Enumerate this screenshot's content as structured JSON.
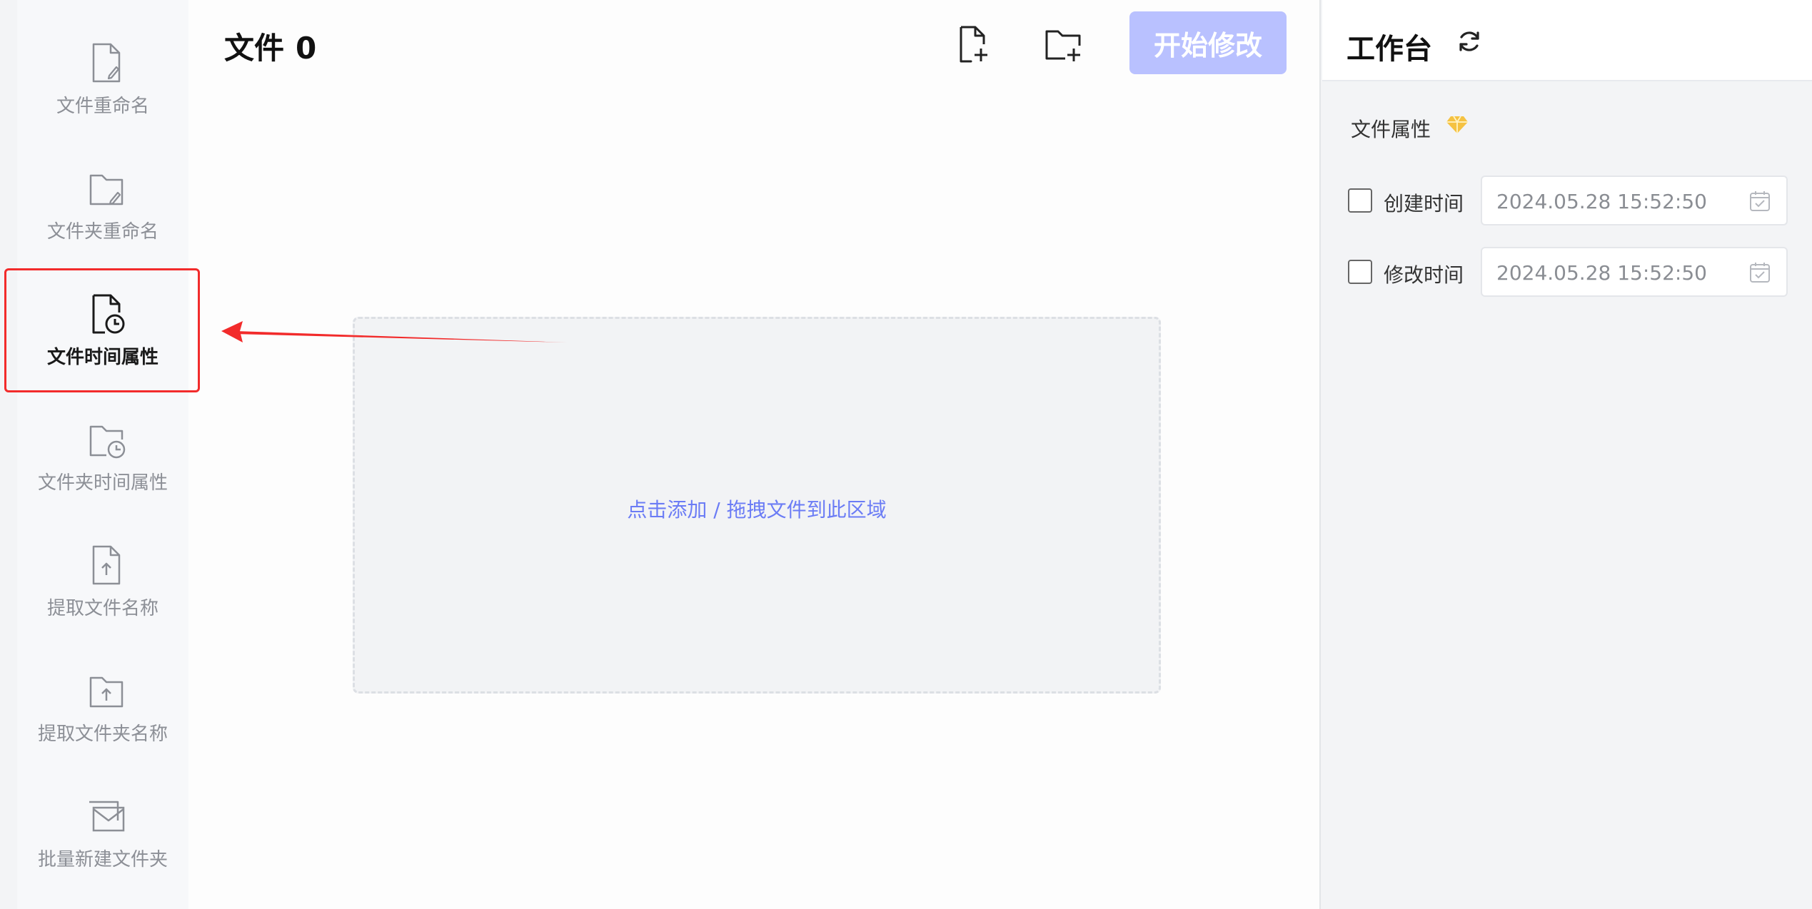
{
  "sidebar": {
    "items": [
      {
        "label": "文件重命名",
        "icon": "file-edit-icon"
      },
      {
        "label": "文件夹重命名",
        "icon": "folder-edit-icon"
      },
      {
        "label": "文件时间属性",
        "icon": "file-clock-icon",
        "active": true
      },
      {
        "label": "文件夹时间属性",
        "icon": "folder-clock-icon"
      },
      {
        "label": "提取文件名称",
        "icon": "file-upload-icon"
      },
      {
        "label": "提取文件夹名称",
        "icon": "folder-upload-icon"
      },
      {
        "label": "批量新建文件夹",
        "icon": "folder-stack-icon"
      }
    ]
  },
  "main": {
    "title": "文件",
    "file_count": "0",
    "add_file_icon": "file-add-icon",
    "add_folder_icon": "folder-add-icon",
    "start_label": "开始修改",
    "drop_hint": "点击添加 / 拖拽文件到此区域"
  },
  "panel": {
    "title": "工作台",
    "refresh_icon": "refresh-icon",
    "section_title": "文件属性",
    "premium_icon": "diamond-icon",
    "created_label": "创建时间",
    "created_value": "2024.05.28 15:52:50",
    "modified_label": "修改时间",
    "modified_value": "2024.05.28 15:52:50",
    "calendar_icon": "calendar-icon"
  },
  "colors": {
    "accent": "#6b7cf5",
    "start_button": "#b9c1ff",
    "highlight": "#f22b2b",
    "premium": "#f5c242"
  }
}
